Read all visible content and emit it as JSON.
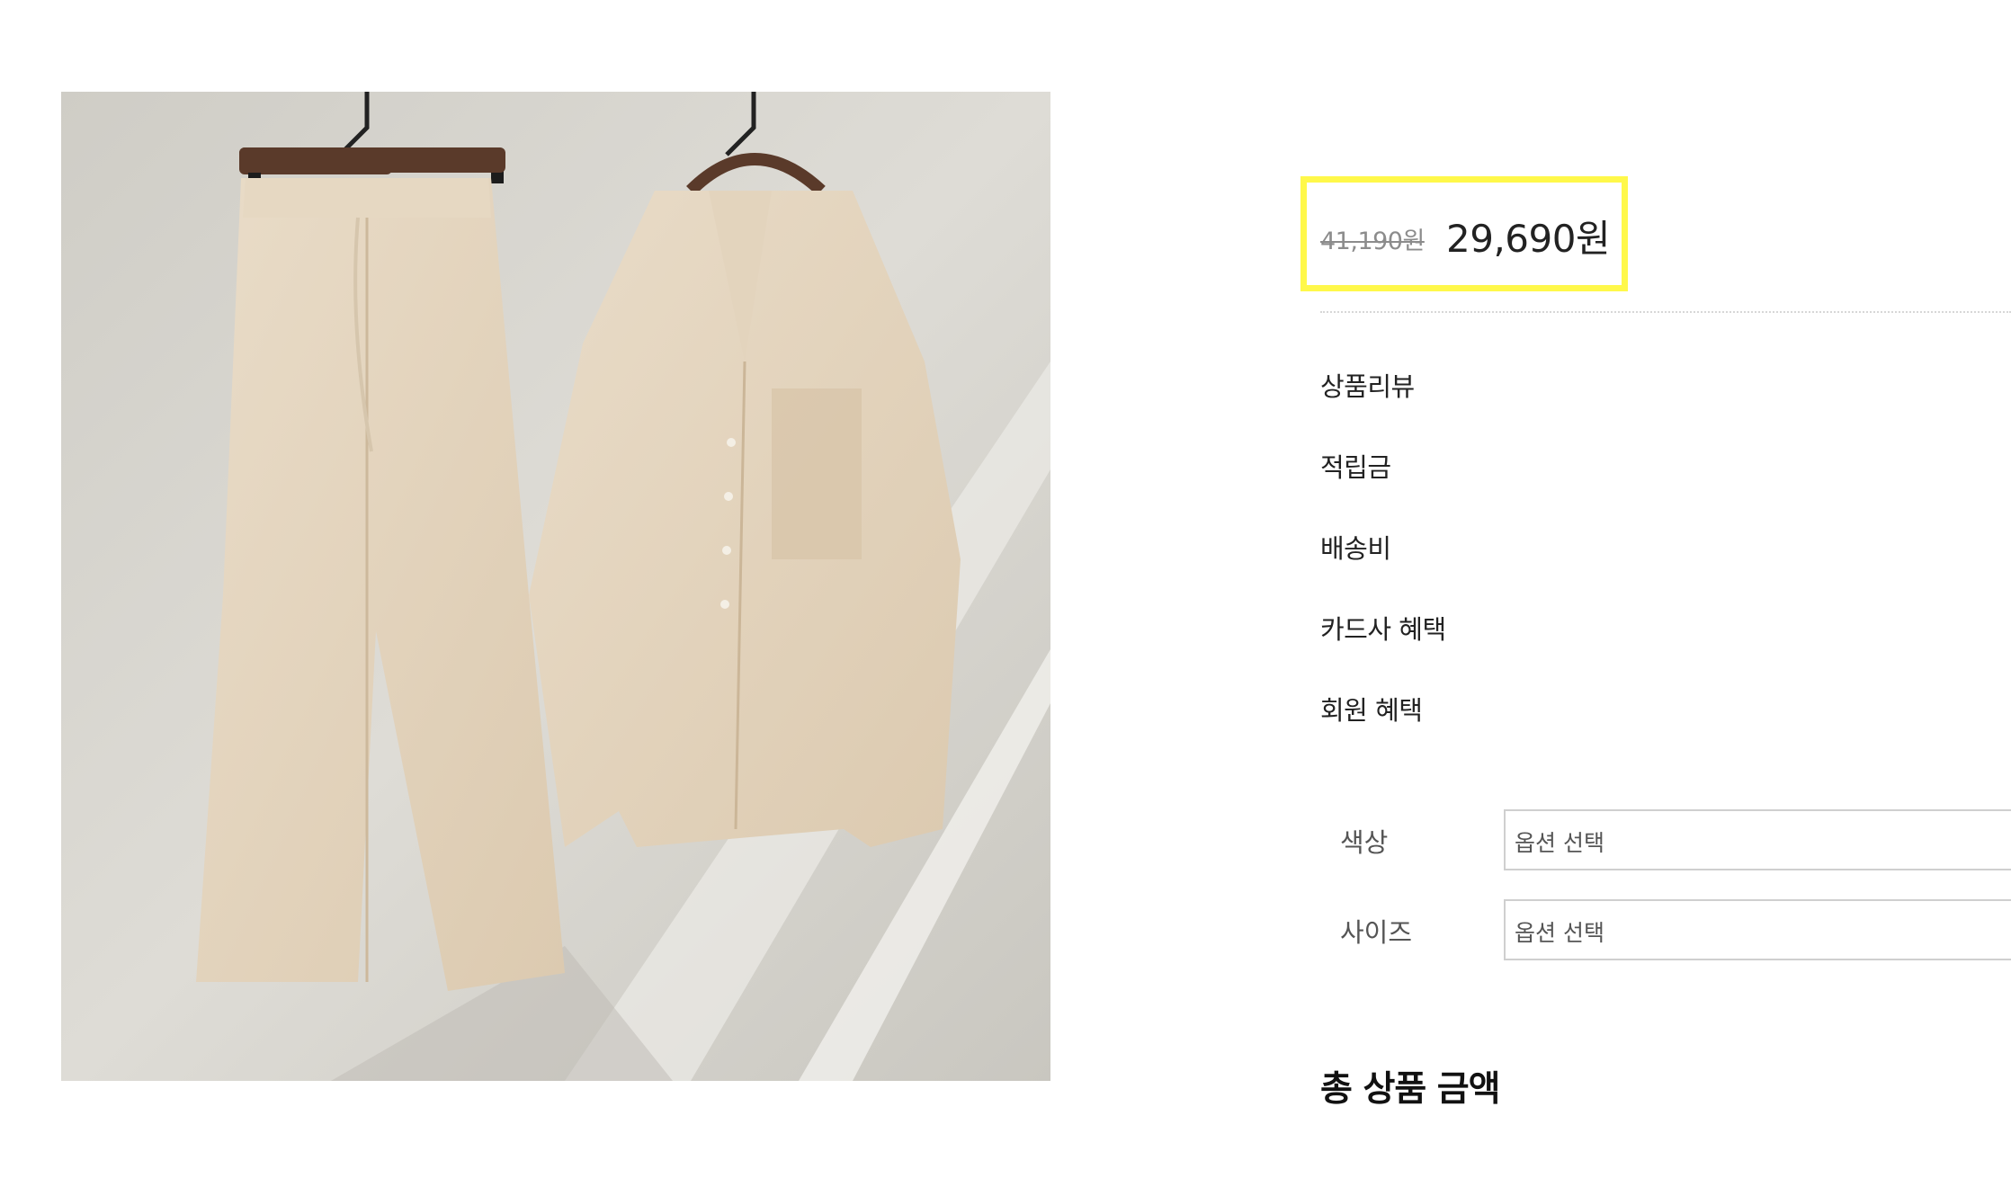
{
  "product": {
    "image_alt": "product-photo",
    "price": {
      "original": "41,190원",
      "sale": "29,690원"
    },
    "details": [
      {
        "label": "상품리뷰"
      },
      {
        "label": "적립금"
      },
      {
        "label": "배송비"
      },
      {
        "label": "카드사 혜택"
      },
      {
        "label": "회원 혜택"
      }
    ],
    "options": [
      {
        "label": "색상",
        "value": "옵션 선택"
      },
      {
        "label": "사이즈",
        "value": "옵션 선택"
      }
    ],
    "total_label": "총 상품 금액"
  },
  "colors": {
    "highlight": "#fff84a",
    "strike_price": "#8c8c8c"
  }
}
